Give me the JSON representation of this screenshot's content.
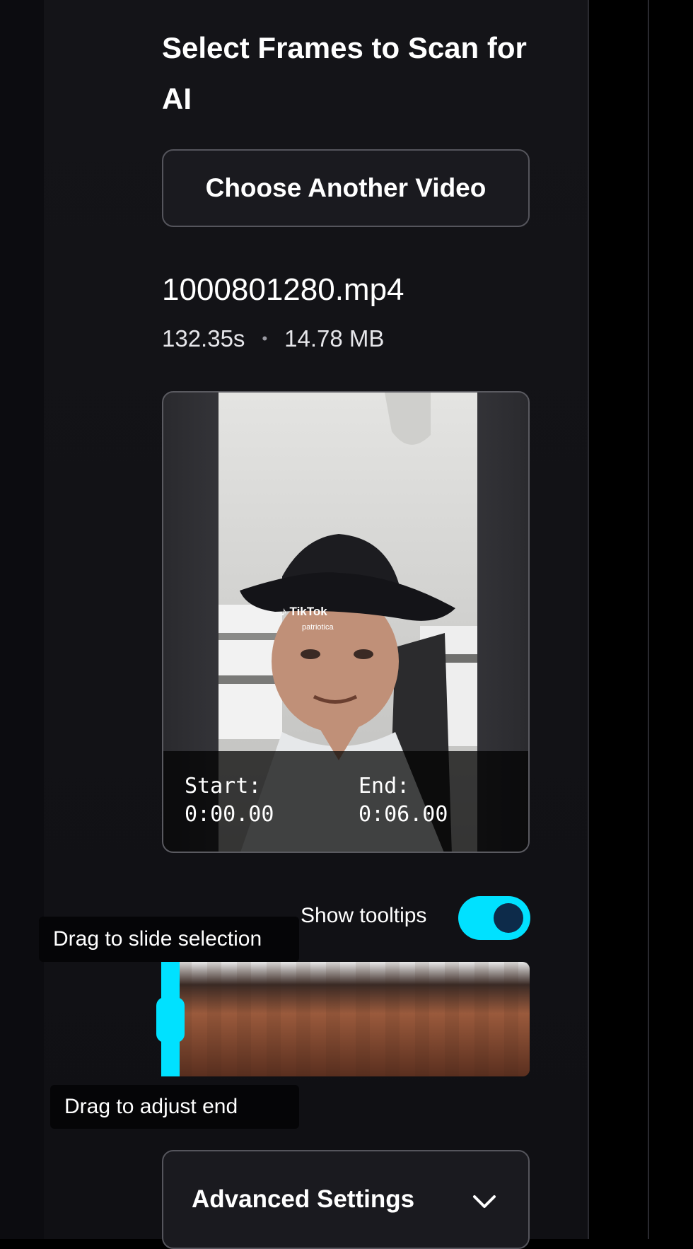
{
  "panel": {
    "title": "Select Frames to Scan for AI",
    "choose_button": "Choose Another Video"
  },
  "file": {
    "name": "1000801280.mp4",
    "duration": "132.35s",
    "separator": "•",
    "size": "14.78 MB"
  },
  "preview": {
    "watermark_brand": "TikTok",
    "watermark_handle": "patriotica",
    "start_label": "Start:",
    "start_time": "0:00.00",
    "end_label": "End:",
    "end_time": "0:06.00"
  },
  "tooltips_toggle": {
    "label": "Show tooltips",
    "enabled": true,
    "accent_color": "#00e1ff"
  },
  "timeline": {
    "tooltip_slide": "Drag to slide selection",
    "tooltip_end": "Drag to adjust end"
  },
  "advanced": {
    "label": "Advanced Settings",
    "icon": "chevron-down-icon"
  }
}
